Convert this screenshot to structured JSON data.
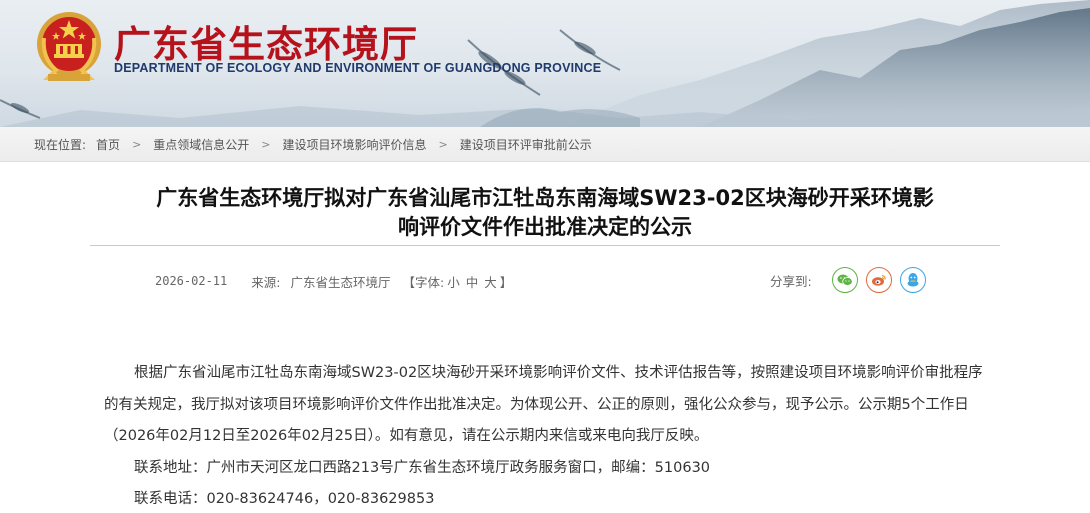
{
  "header": {
    "title": "广东省生态环境厅",
    "subtitle": "DEPARTMENT OF ECOLOGY AND ENVIRONMENT OF GUANGDONG PROVINCE"
  },
  "breadcrumb": {
    "here_label": "现在位置:",
    "items": [
      "首页",
      "重点领域信息公开",
      "建设项目环境影响评价信息",
      "建设项目环评审批前公示"
    ]
  },
  "article": {
    "title_line1": "广东省生态环境厅拟对广东省汕尾市江牡岛东南海域SW23-02区块海砂开采环境影",
    "title_line2": "响评价文件作出批准决定的公示",
    "date": "2026-02-11",
    "source_label": "来源:",
    "source": "广东省生态环境厅",
    "font_label_open": "【字体:",
    "font_small": "小",
    "font_medium": "中",
    "font_large": "大",
    "font_label_close": "】",
    "share_label": "分享到:",
    "paragraph": "根据广东省汕尾市江牡岛东南海域SW23-02区块海砂开采环境影响评价文件、技术评估报告等，按照建设项目环境影响评价审批程序的有关规定，我厅拟对该项目环境影响评价文件作出批准决定。为体现公开、公正的原则，强化公众参与，现予公示。公示期5个工作日（2026年02月12日至2026年02月25日）。如有意见，请在公示期内来信或来电向我厅反映。",
    "address": "联系地址：广州市天河区龙口西路213号广东省生态环境厅政务服务窗口，邮编：510630",
    "phone": "联系电话：020-83624746，020-83629853"
  },
  "icons": {
    "emblem": "national-emblem-icon",
    "share": [
      "wechat-icon",
      "weibo-icon",
      "qq-icon"
    ]
  },
  "colors": {
    "title_red": "#b5121b",
    "subtitle_blue": "#1f3a6b",
    "wechat": "#5bb543",
    "weibo": "#e06a3c",
    "qq": "#3aa6e8"
  }
}
